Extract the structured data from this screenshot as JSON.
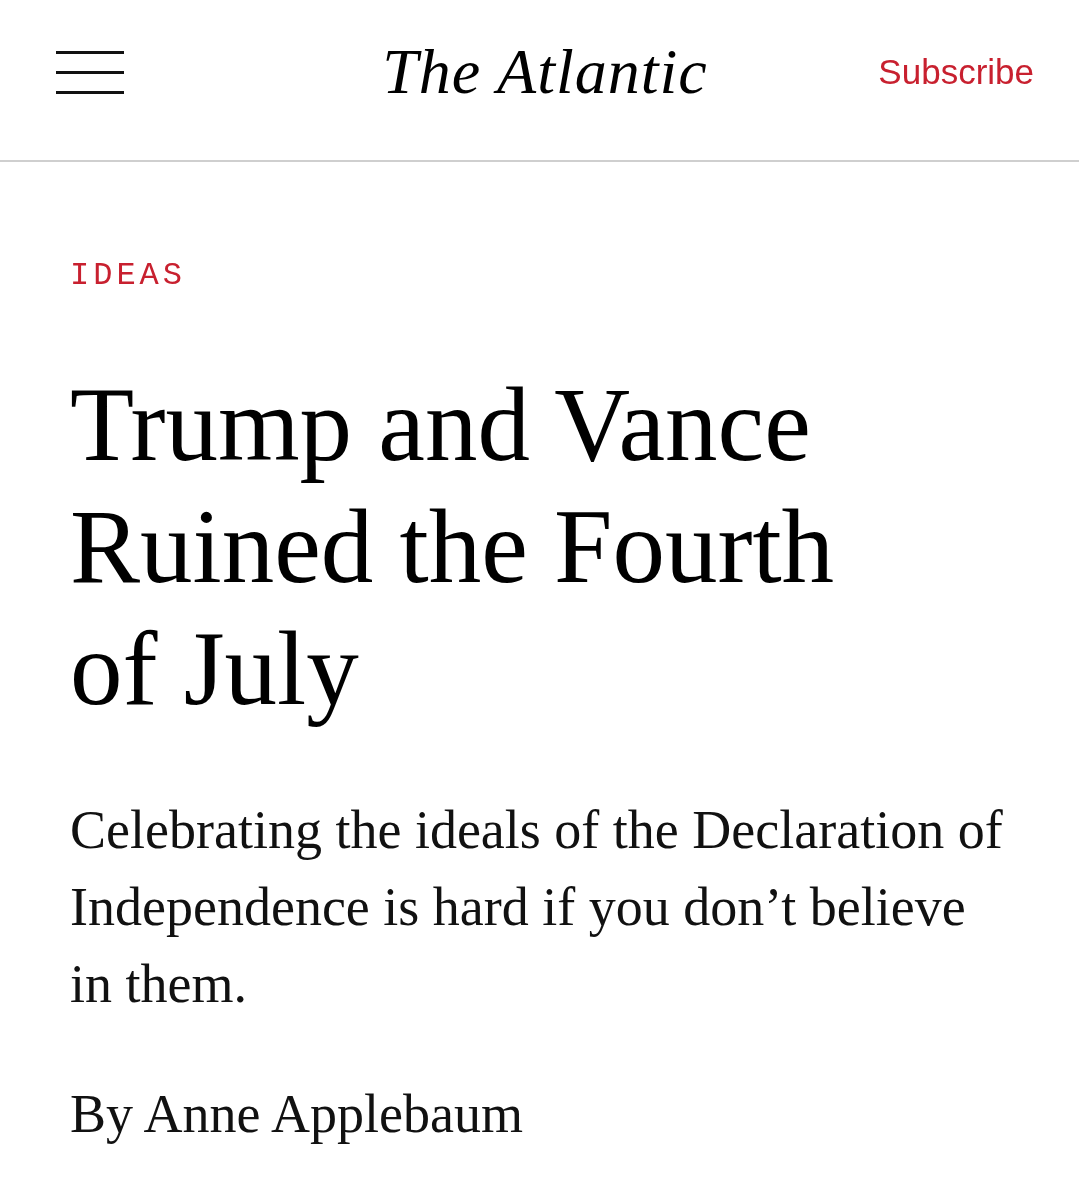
{
  "header": {
    "logo": "The Atlantic",
    "subscribe": "Subscribe"
  },
  "article": {
    "section": "IDEAS",
    "headline": "Trump and Vance Ruined the Fourth of July",
    "dek": "Celebrating the ideals of the Declaration of Independence is hard if you don’t believe in them.",
    "byline": "By Anne Applebaum"
  }
}
